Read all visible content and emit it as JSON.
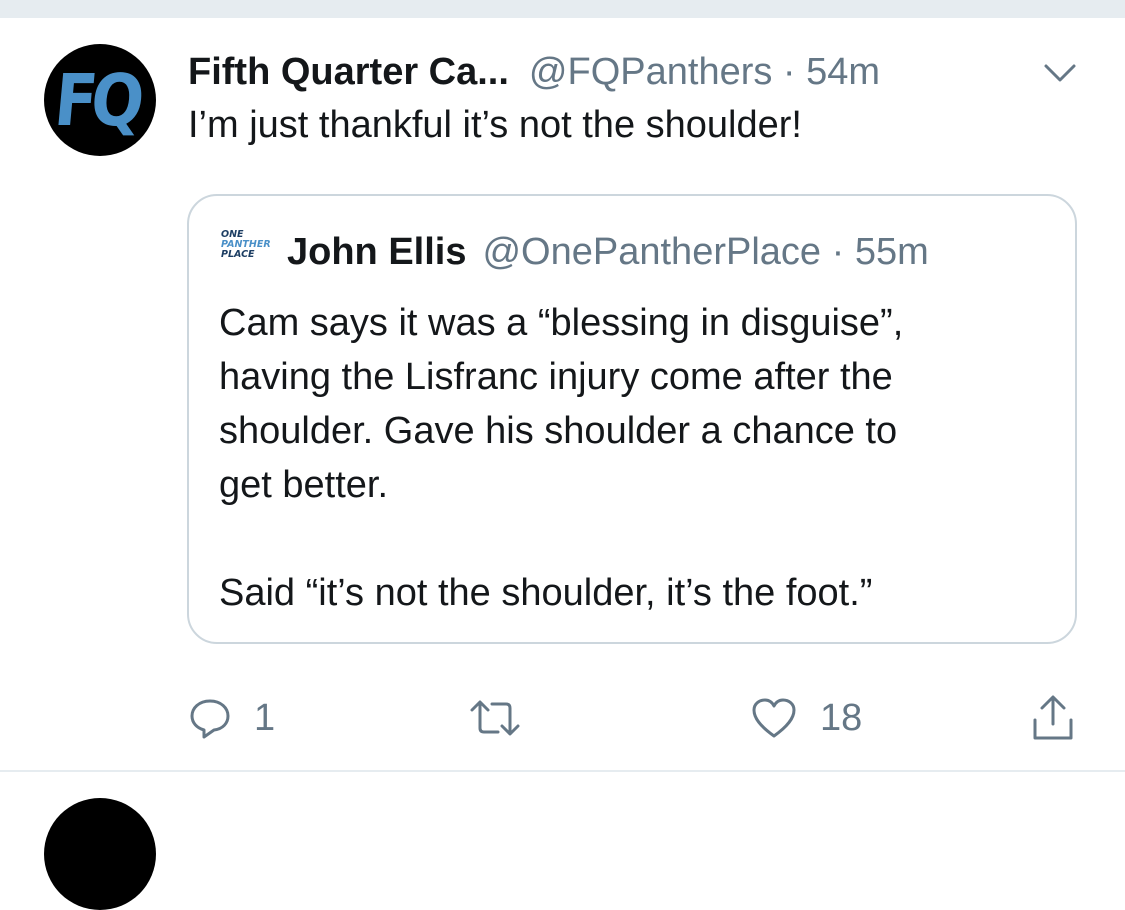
{
  "tweet": {
    "avatar_text": "FQ",
    "display_name": "Fifth Quarter Ca...",
    "handle": "@FQPanthers",
    "separator": "·",
    "time": "54m",
    "text": "I’m just thankful it’s not the shoulder!"
  },
  "quote": {
    "logo_lines": [
      "ONE",
      "PANTHER",
      "PLACE"
    ],
    "display_name": "John Ellis",
    "handle": "@OnePantherPlace",
    "separator": "·",
    "time": "55m",
    "paragraph1": [
      "Cam says it was a “blessing in disguise”,",
      "having the Lisfranc injury come after the",
      "shoulder. Gave his shoulder a chance to",
      "get better."
    ],
    "paragraph2": "Said “it’s not the shoulder, it’s the foot.”"
  },
  "actions": {
    "reply_count": "1",
    "like_count": "18"
  },
  "colors": {
    "text": "#14171a",
    "secondary": "#657786",
    "border": "#ccd6dd",
    "separator_bg": "#e6ecf0",
    "brand_blue": "#4a90c8"
  },
  "icons": {
    "more": "chevron-down-icon",
    "reply": "reply-icon",
    "retweet": "retweet-icon",
    "like": "heart-icon",
    "share": "share-icon"
  }
}
